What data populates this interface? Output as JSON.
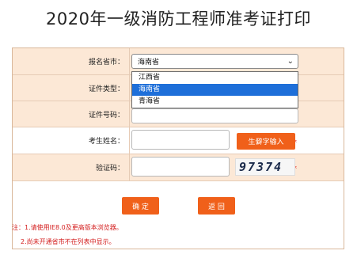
{
  "page_title": "2020年一级消防工程师准考证打印",
  "form": {
    "province_label": "报名省市：",
    "province_selected": "海南省",
    "province_options": [
      "江西省",
      "海南省",
      "青海省"
    ],
    "idtype_label": "证件类型：",
    "idnumber_label": "证件号码：",
    "name_label": "考生姓名：",
    "rare_char_button": "生僻字输入",
    "captcha_label": "验证码：",
    "captcha_text": "97374",
    "required_mark": "*"
  },
  "buttons": {
    "confirm": "确 定",
    "back": "返 回"
  },
  "notes": [
    "注：1.请使用IE8.0及更高版本浏览器。",
    "2.尚未开通省市不在列表中显示。"
  ],
  "colors": {
    "row_bg": "#fce8d6",
    "border": "#d9b79a",
    "button": "#f0601a",
    "required": "#e01010",
    "dropdown_selected": "#1e6fd9"
  }
}
